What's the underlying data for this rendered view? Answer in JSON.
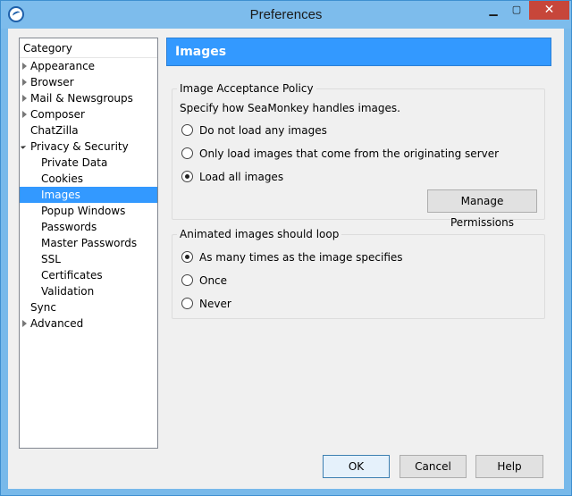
{
  "window": {
    "title": "Preferences",
    "controls": {
      "minimize": "▁",
      "maximize": "▢",
      "close": "✕"
    }
  },
  "tree": {
    "header": "Category",
    "items": [
      {
        "label": "Appearance",
        "level": 0,
        "twisty": "closed"
      },
      {
        "label": "Browser",
        "level": 0,
        "twisty": "closed"
      },
      {
        "label": "Mail & Newsgroups",
        "level": 0,
        "twisty": "closed"
      },
      {
        "label": "Composer",
        "level": 0,
        "twisty": "closed"
      },
      {
        "label": "ChatZilla",
        "level": 0,
        "twisty": "none"
      },
      {
        "label": "Privacy & Security",
        "level": 0,
        "twisty": "open"
      },
      {
        "label": "Private Data",
        "level": 1
      },
      {
        "label": "Cookies",
        "level": 1
      },
      {
        "label": "Images",
        "level": 1,
        "selected": true
      },
      {
        "label": "Popup Windows",
        "level": 1
      },
      {
        "label": "Passwords",
        "level": 1
      },
      {
        "label": "Master Passwords",
        "level": 1
      },
      {
        "label": "SSL",
        "level": 1
      },
      {
        "label": "Certificates",
        "level": 1
      },
      {
        "label": "Validation",
        "level": 1
      },
      {
        "label": "Sync",
        "level": 0,
        "twisty": "none"
      },
      {
        "label": "Advanced",
        "level": 0,
        "twisty": "closed"
      }
    ]
  },
  "panel": {
    "title": "Images",
    "acceptance": {
      "caption": "Image Acceptance Policy",
      "description": "Specify how SeaMonkey handles images.",
      "options": [
        {
          "label": "Do not load any images",
          "checked": false
        },
        {
          "label": "Only load images that come from the originating server",
          "checked": false
        },
        {
          "label": "Load all images",
          "checked": true
        }
      ],
      "manage_button": "Manage Permissions"
    },
    "animation": {
      "caption": "Animated images should loop",
      "options": [
        {
          "label": "As many times as the image specifies",
          "checked": true
        },
        {
          "label": "Once",
          "checked": false
        },
        {
          "label": "Never",
          "checked": false
        }
      ]
    }
  },
  "buttons": {
    "ok": "OK",
    "cancel": "Cancel",
    "help": "Help"
  },
  "colors": {
    "accent": "#3399ff",
    "titlebar": "#7dbcec",
    "close": "#c7463a"
  }
}
